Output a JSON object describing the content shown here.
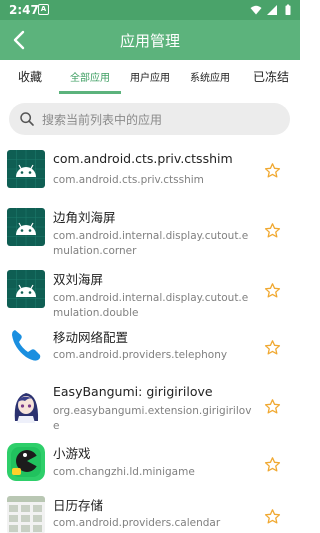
{
  "status_bar": {
    "time": "2:47",
    "notification_badge": "A"
  },
  "app_bar": {
    "title": "应用管理"
  },
  "tabs": [
    {
      "label": "收藏"
    },
    {
      "label": "全部应用"
    },
    {
      "label": "用户应用"
    },
    {
      "label": "系统应用"
    },
    {
      "label": "已冻结"
    }
  ],
  "active_tab": 1,
  "search": {
    "placeholder": "搜索当前列表中的应用"
  },
  "colors": {
    "primary": "#5cb37c",
    "status_bar": "#4aa36a",
    "star": "#f0a830"
  },
  "apps": [
    {
      "name": "com.android.cts.priv.ctsshim",
      "package": "com.android.cts.priv.ctsshim",
      "icon": "android-robot-icon"
    },
    {
      "name": "边角刘海屏",
      "package": "com.android.internal.display.cutout.emulation.corner",
      "icon": "android-robot-icon"
    },
    {
      "name": "双刘海屏",
      "package": "com.android.internal.display.cutout.emulation.double",
      "icon": "android-robot-icon"
    },
    {
      "name": "移动网络配置",
      "package": "com.android.providers.telephony",
      "icon": "phone-icon"
    },
    {
      "name": "EasyBangumi: girigirilove",
      "package": "org.easybangumi.extension.girigirilove",
      "icon": "anime-girl-icon"
    },
    {
      "name": "小游戏",
      "package": "com.changzhi.ld.minigame",
      "icon": "game-icon"
    },
    {
      "name": "日历存储",
      "package": "com.android.providers.calendar",
      "icon": "calendar-icon"
    }
  ]
}
